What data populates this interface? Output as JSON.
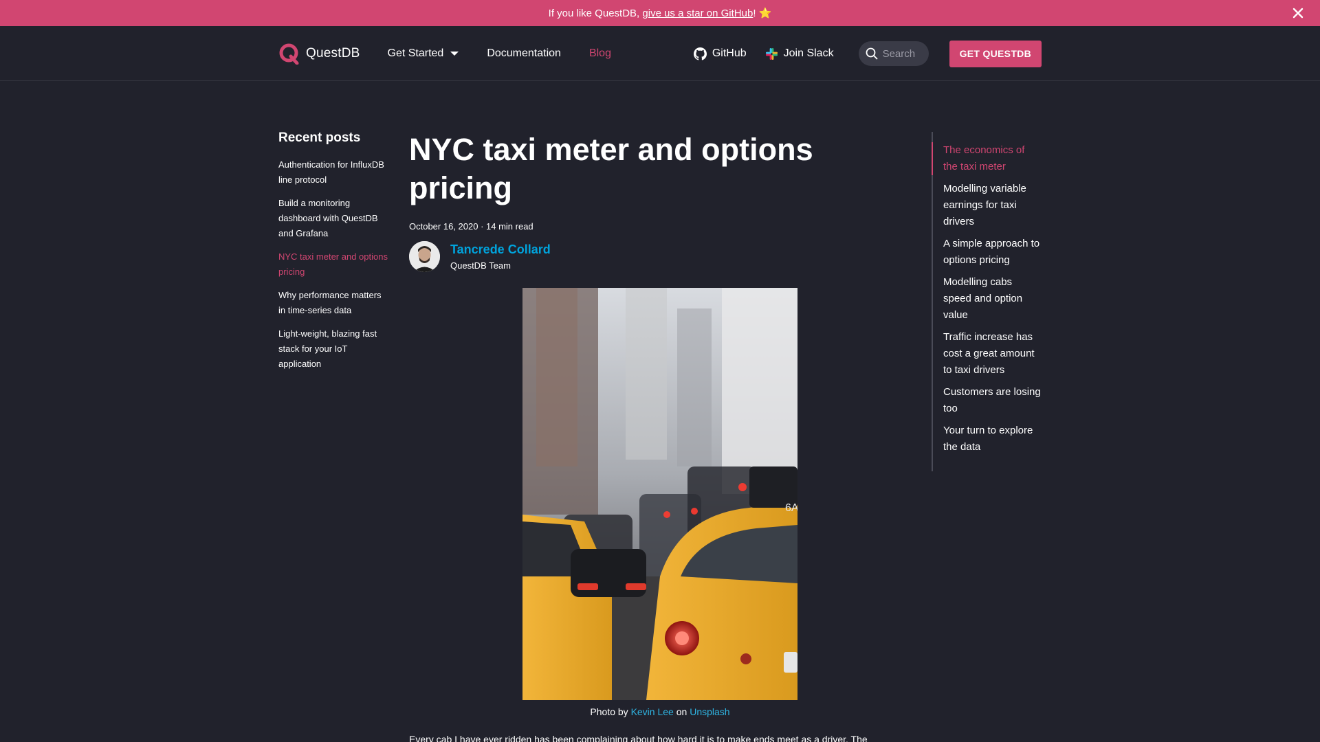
{
  "announcement": {
    "prefix": "If you like QuestDB, ",
    "link": "give us a star on GitHub",
    "suffix": "! ⭐"
  },
  "navbar": {
    "logo_text": "QuestDB",
    "items": [
      {
        "label": "Get Started"
      },
      {
        "label": "Documentation"
      },
      {
        "label": "Blog"
      }
    ],
    "github": "GitHub",
    "slack": "Join Slack",
    "search_placeholder": "Search",
    "cta": "GET QUESTDB"
  },
  "sidebar": {
    "title": "Recent posts",
    "posts": [
      "Authentication for InfluxDB line protocol",
      "Build a monitoring dashboard with QuestDB and Grafana",
      "NYC taxi meter and options pricing",
      "Why performance matters in time-series data",
      "Light-weight, blazing fast stack for your IoT application"
    ]
  },
  "article": {
    "title": "NYC taxi meter and options pricing",
    "meta": "October 16, 2020 · 14 min read",
    "author_name": "Tancrede Collard",
    "author_role": "QuestDB Team",
    "caption_prefix": "Photo by ",
    "caption_author": "Kevin Lee",
    "caption_mid": " on ",
    "caption_source": "Unsplash",
    "body_start": "Every cab I have ever ridden has been complaining about how hard it is to make ends meet as a driver. The"
  },
  "toc": {
    "items": [
      "The economics of the taxi meter",
      "Modelling variable earnings for taxi drivers",
      "A simple approach to options pricing",
      "Modelling cabs speed and option value",
      "Traffic increase has cost a great amount to taxi drivers",
      "Customers are losing too",
      "Your turn to explore the data"
    ]
  },
  "colors": {
    "accent": "#d14671",
    "background": "#21222c",
    "link": "#00a3dc"
  }
}
